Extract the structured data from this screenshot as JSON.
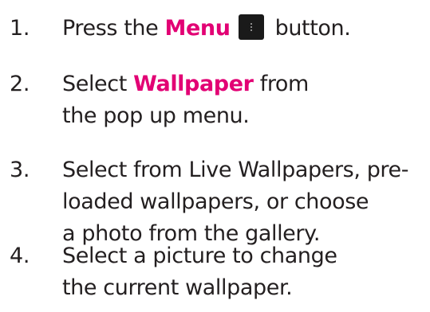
{
  "accent_color": "#e20074",
  "icons": {
    "menu_button": "menu-icon"
  },
  "steps": [
    {
      "number": "1.",
      "before": "Press the ",
      "highlight": "Menu",
      "after": "button."
    },
    {
      "number": "2.",
      "before": "Select ",
      "highlight": "Wallpaper",
      "after": " from",
      "line2": "the pop up menu."
    },
    {
      "number": "3.",
      "line1": "Select from Live Wallpapers, pre-",
      "line2": "loaded wallpapers, or choose",
      "line3": "a photo from the gallery."
    },
    {
      "number": "4.",
      "line1": "Select a picture to change",
      "line2": "the current wallpaper."
    }
  ]
}
